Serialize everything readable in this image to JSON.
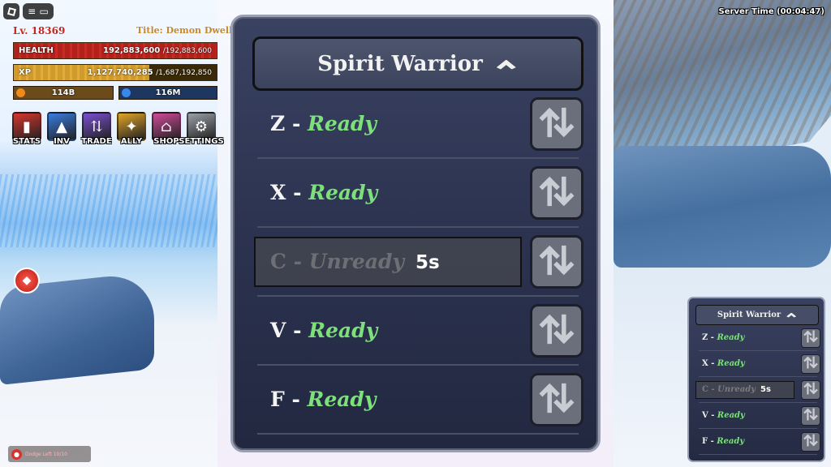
{
  "hud": {
    "level": "Lv. 18369",
    "title": "Title: Demon Dweller",
    "health": {
      "label": "HEALTH",
      "current": "192,883,600",
      "max": "/192,883,600",
      "fraction": 1.0
    },
    "xp": {
      "label": "XP",
      "current": "1,127,740,285",
      "max": "/1,687,192,850",
      "fraction": 0.668
    },
    "gold": "114B",
    "gems": "116M",
    "menu": [
      {
        "label": "STATS",
        "icon": "stats-icon",
        "color": "#d7352d"
      },
      {
        "label": "INV",
        "icon": "inventory-icon",
        "color": "#3a7ce0"
      },
      {
        "label": "TRADE",
        "icon": "trade-icon",
        "color": "#7a4fd0"
      },
      {
        "label": "ALLY",
        "icon": "ally-icon",
        "color": "#e0a528"
      },
      {
        "label": "SHOP",
        "icon": "shop-icon",
        "color": "#d04a9a"
      },
      {
        "label": "SETTINGS",
        "icon": "settings-icon",
        "color": "#9aa0a8"
      }
    ],
    "dodge": "Dodge Left 10/10",
    "server_time": "Server Time (00:04:47)"
  },
  "panel": {
    "title": "Spirit Warrior",
    "skills": [
      {
        "key": "Z",
        "sep": " - ",
        "status": "Ready",
        "ready": true,
        "cooldown": ""
      },
      {
        "key": "X",
        "sep": " - ",
        "status": "Ready",
        "ready": true,
        "cooldown": ""
      },
      {
        "key": "C",
        "sep": " - ",
        "status": "Unready",
        "ready": false,
        "cooldown": "5s"
      },
      {
        "key": "V",
        "sep": " - ",
        "status": "Ready",
        "ready": true,
        "cooldown": ""
      },
      {
        "key": "F",
        "sep": " - ",
        "status": "Ready",
        "ready": true,
        "cooldown": ""
      }
    ]
  },
  "colors": {
    "ready": "#7de07a",
    "panel_bg": "#2c3350",
    "health": "#c82a24",
    "xp": "#e0ac3a"
  }
}
